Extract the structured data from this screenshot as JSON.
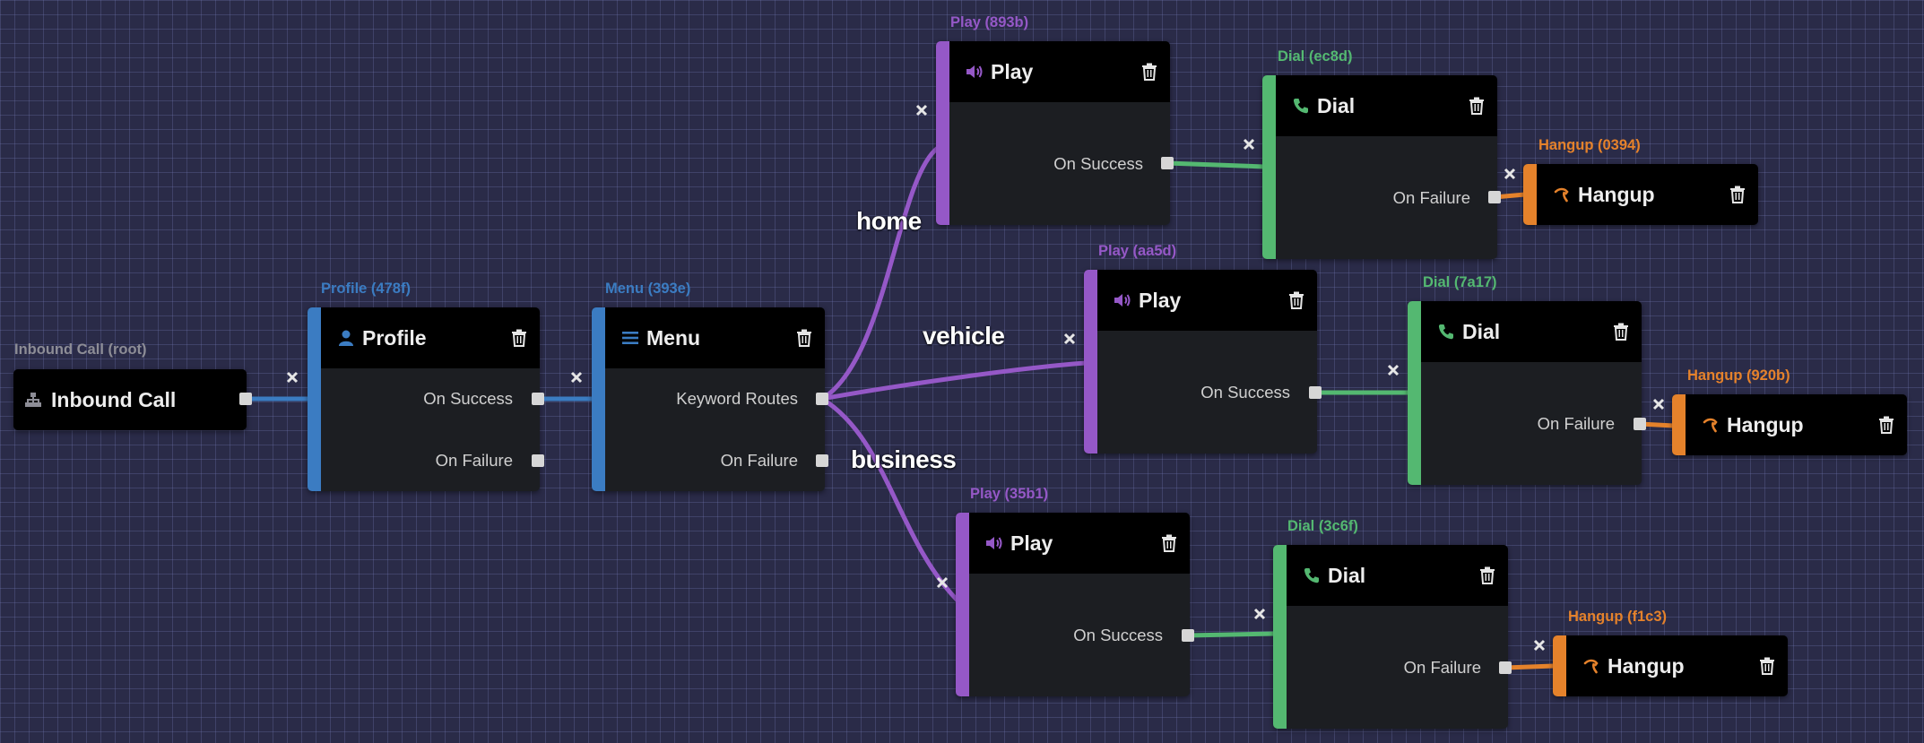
{
  "colors": {
    "root": "#8d8d96",
    "profile": "#3b7cc2",
    "menu": "#3b7cc2",
    "play": "#9558c7",
    "dial": "#54b871",
    "hangup": "#e5822b",
    "port": "#d6d6d6",
    "node_body": "#1c1e22",
    "node_header": "#000000",
    "canvas_background": "#2a2b48"
  },
  "nodes": {
    "inbound": {
      "label": "Inbound Call (root)",
      "title": "Inbound Call",
      "icon": "sitemap-icon"
    },
    "profile": {
      "label": "Profile (478f)",
      "title": "Profile",
      "icon": "user-icon",
      "on_success": "On Success",
      "on_failure": "On Failure"
    },
    "menu": {
      "label": "Menu (393e)",
      "title": "Menu",
      "icon": "list-icon",
      "keyword_routes": "Keyword Routes",
      "on_failure": "On Failure"
    },
    "play_893b": {
      "label": "Play (893b)",
      "title": "Play",
      "icon": "speaker-icon",
      "on_success": "On Success"
    },
    "play_aa5d": {
      "label": "Play (aa5d)",
      "title": "Play",
      "icon": "speaker-icon",
      "on_success": "On Success"
    },
    "play_35b1": {
      "label": "Play (35b1)",
      "title": "Play",
      "icon": "speaker-icon",
      "on_success": "On Success"
    },
    "dial_ec8d": {
      "label": "Dial (ec8d)",
      "title": "Dial",
      "icon": "phone-icon",
      "on_failure": "On Failure"
    },
    "dial_7a17": {
      "label": "Dial (7a17)",
      "title": "Dial",
      "icon": "phone-icon",
      "on_failure": "On Failure"
    },
    "dial_3c6f": {
      "label": "Dial (3c6f)",
      "title": "Dial",
      "icon": "phone-icon",
      "on_failure": "On Failure"
    },
    "hangup_0394": {
      "label": "Hangup (0394)",
      "title": "Hangup",
      "icon": "hangup-icon"
    },
    "hangup_920b": {
      "label": "Hangup (920b)",
      "title": "Hangup",
      "icon": "hangup-icon"
    },
    "hangup_f1c3": {
      "label": "Hangup (f1c3)",
      "title": "Hangup",
      "icon": "hangup-icon"
    }
  },
  "routes": {
    "home": "home",
    "vehicle": "vehicle",
    "business": "business"
  }
}
